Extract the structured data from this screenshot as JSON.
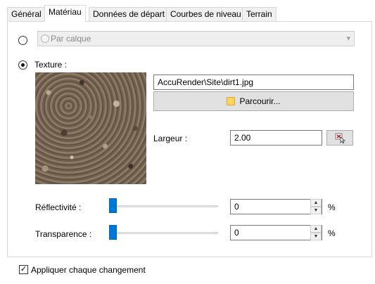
{
  "tabs": [
    {
      "label": "Général"
    },
    {
      "label": "Matériau"
    },
    {
      "label": "Données de départ"
    },
    {
      "label": "Courbes de niveau"
    },
    {
      "label": "Terrain"
    }
  ],
  "by_layer": {
    "combo_value": "Par calque"
  },
  "texture": {
    "label": "Texture :",
    "path": "AccuRender\\Site\\dirt1.jpg",
    "browse_label": "Parcourir...",
    "width_label": "Largeur :",
    "width_value": "2.00"
  },
  "reflectivity": {
    "label": "Réflectivité :",
    "value": "0",
    "unit": "%",
    "level": 0
  },
  "transparency": {
    "label": "Transparence :",
    "value": "0",
    "unit": "%",
    "level": 0
  },
  "apply_each_change": {
    "label": "Appliquer chaque changement",
    "checked": true
  }
}
